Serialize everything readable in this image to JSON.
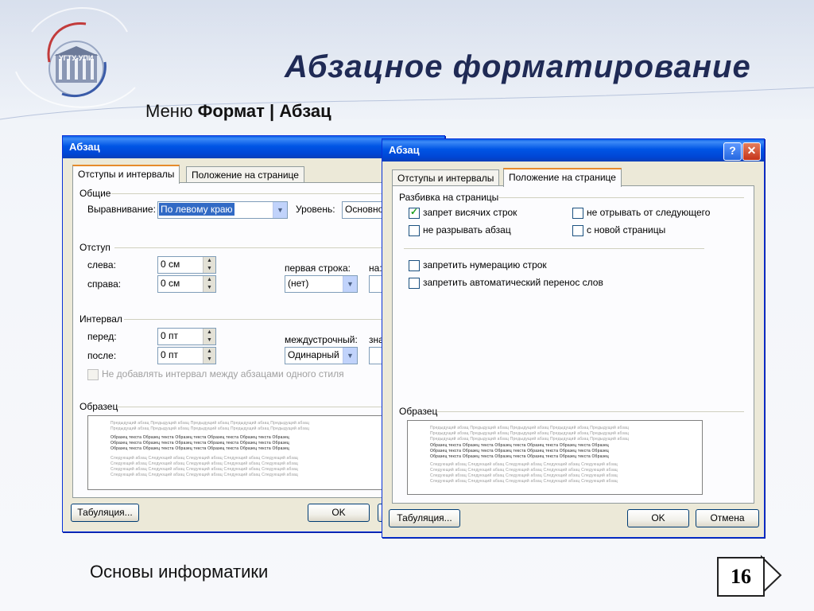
{
  "slide": {
    "title": "Абзацное форматирование",
    "subtitle_prefix": "Меню ",
    "subtitle_bold": "Формат | Абзац",
    "footer": "Основы информатики",
    "page_number": "16",
    "logo_text": "УГТУ-УПИ"
  },
  "dialog1": {
    "title": "Абзац",
    "tabs": [
      "Отступы и интервалы",
      "Положение на странице"
    ],
    "groups": {
      "general": "Общие",
      "indent": "Отступ",
      "interval": "Интервал",
      "sample": "Образец"
    },
    "alignment_label": "Выравнивание:",
    "alignment_value": "По левому краю",
    "level_label": "Уровень:",
    "level_value": "Основной",
    "left_label": "слева:",
    "left_value": "0 см",
    "right_label": "справа:",
    "right_value": "0 см",
    "first_line_label": "первая строка:",
    "first_line_value": "(нет)",
    "on_label": "на:",
    "before_label": "перед:",
    "before_value": "0 пт",
    "after_label": "после:",
    "after_value": "0 пт",
    "line_spacing_label": "междустрочный:",
    "line_spacing_value": "Одинарный",
    "value_label": "знач",
    "no_space_label": "Не добавлять интервал между абзацами одного стиля",
    "tabs_button": "Табуляция...",
    "ok_button": "OK"
  },
  "dialog2": {
    "title": "Абзац",
    "tabs": [
      "Отступы и интервалы",
      "Положение на странице"
    ],
    "pagination_group": "Разбивка на страницы",
    "options": [
      {
        "label": "запрет висячих строк",
        "checked": true
      },
      {
        "label": "не отрывать от следующего",
        "checked": false
      },
      {
        "label": "не разрывать абзац",
        "checked": false
      },
      {
        "label": "с новой страницы",
        "checked": false
      },
      {
        "label": "запретить нумерацию строк",
        "checked": false
      },
      {
        "label": "запретить автоматический перенос слов",
        "checked": false
      }
    ],
    "sample_group": "Образец",
    "tabs_button": "Табуляция...",
    "ok_button": "OK",
    "cancel_button": "Отмена"
  },
  "preview_text": {
    "prev": "Предыдущий абзац Предыдущий абзац Предыдущий абзац Предыдущий абзац Предыдущий абзац",
    "sample": "Образец текста Образец текста Образец текста Образец текста Образец текста Образец",
    "next": "Следующий абзац Следующий абзац Следующий абзац Следующий абзац Следующий абзац"
  },
  "colors": {
    "title": "#1f2a55",
    "xp_titlebar": "#0055e5",
    "dialog_face": "#ece9d8"
  }
}
